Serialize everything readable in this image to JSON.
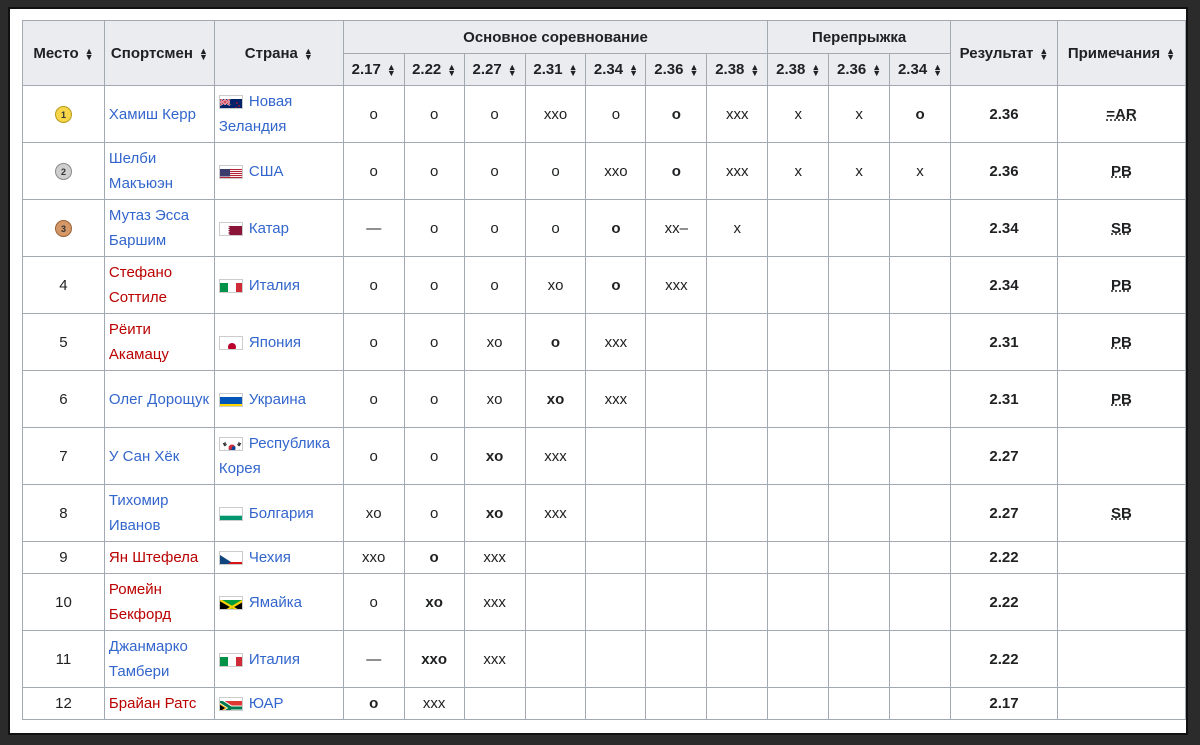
{
  "headers": {
    "place": "Место",
    "athlete": "Спортсмен",
    "country": "Страна",
    "main": "Основное соревнование",
    "jumpoff": "Перепрыжка",
    "result": "Результат",
    "notes": "Примечания",
    "heights_main": [
      "2.17",
      "2.22",
      "2.27",
      "2.31",
      "2.34",
      "2.36",
      "2.38"
    ],
    "heights_jumpoff": [
      "2.38",
      "2.36",
      "2.34"
    ]
  },
  "rows": [
    {
      "place": "",
      "medal": "gold",
      "medal_text": "1",
      "athlete": "Хамиш Керр",
      "athlete_link": "blue",
      "country": "Новая Зеландия",
      "flag": "nz",
      "attempts": [
        "o",
        "o",
        "o",
        "xxo",
        "o",
        "o",
        "xxx",
        "x",
        "x",
        "o"
      ],
      "bold": [
        5,
        9
      ],
      "result": "2.36",
      "note": "=AR"
    },
    {
      "place": "",
      "medal": "silver",
      "medal_text": "2",
      "athlete": "Шелби Макъюэн",
      "athlete_link": "blue",
      "country": "США",
      "flag": "us",
      "attempts": [
        "o",
        "o",
        "o",
        "o",
        "xxo",
        "o",
        "xxx",
        "x",
        "x",
        "x"
      ],
      "bold": [
        5
      ],
      "result": "2.36",
      "note": "PB"
    },
    {
      "place": "",
      "medal": "bronze",
      "medal_text": "3",
      "athlete": "Мутаз Эсса Баршим",
      "athlete_link": "blue",
      "country": "Катар",
      "flag": "qa",
      "attempts": [
        "—",
        "o",
        "o",
        "o",
        "o",
        "xx–",
        "x",
        "",
        "",
        ""
      ],
      "bold": [
        4
      ],
      "result": "2.34",
      "note": "SB"
    },
    {
      "place": "4",
      "medal": "",
      "medal_text": "",
      "athlete": "Стефано Соттиле",
      "athlete_link": "red",
      "country": "Италия",
      "flag": "it",
      "attempts": [
        "o",
        "o",
        "o",
        "xo",
        "o",
        "xxx",
        "",
        "",
        "",
        ""
      ],
      "bold": [
        4
      ],
      "result": "2.34",
      "note": "PB"
    },
    {
      "place": "5",
      "medal": "",
      "medal_text": "",
      "athlete": "Рёити Акамацу",
      "athlete_link": "red",
      "country": "Япония",
      "flag": "jp",
      "attempts": [
        "o",
        "o",
        "xo",
        "o",
        "xxx",
        "",
        "",
        "",
        "",
        ""
      ],
      "bold": [
        3
      ],
      "result": "2.31",
      "note": "PB"
    },
    {
      "place": "6",
      "medal": "",
      "medal_text": "",
      "athlete": "Олег Дорощук",
      "athlete_link": "blue",
      "country": "Украина",
      "flag": "ua",
      "attempts": [
        "o",
        "o",
        "xo",
        "xo",
        "xxx",
        "",
        "",
        "",
        "",
        ""
      ],
      "bold": [
        3
      ],
      "result": "2.31",
      "note": "PB"
    },
    {
      "place": "7",
      "medal": "",
      "medal_text": "",
      "athlete": "У Сан Хёк",
      "athlete_link": "blue",
      "country": "Республика Корея",
      "flag": "kr",
      "attempts": [
        "o",
        "o",
        "xo",
        "xxx",
        "",
        "",
        "",
        "",
        "",
        ""
      ],
      "bold": [
        2
      ],
      "result": "2.27",
      "note": ""
    },
    {
      "place": "8",
      "medal": "",
      "medal_text": "",
      "athlete": "Тихомир Иванов",
      "athlete_link": "blue",
      "country": "Болгария",
      "flag": "bg",
      "attempts": [
        "xo",
        "o",
        "xo",
        "xxx",
        "",
        "",
        "",
        "",
        "",
        ""
      ],
      "bold": [
        2
      ],
      "result": "2.27",
      "note": "SB"
    },
    {
      "place": "9",
      "medal": "",
      "medal_text": "",
      "athlete": "Ян Штефела",
      "athlete_link": "red",
      "country": "Чехия",
      "flag": "cz",
      "attempts": [
        "xxo",
        "o",
        "xxx",
        "",
        "",
        "",
        "",
        "",
        "",
        ""
      ],
      "bold": [
        1
      ],
      "result": "2.22",
      "note": "",
      "short": true
    },
    {
      "place": "10",
      "medal": "",
      "medal_text": "",
      "athlete": "Ромейн Бекфорд",
      "athlete_link": "red",
      "country": "Ямайка",
      "flag": "jm",
      "attempts": [
        "o",
        "xo",
        "xxx",
        "",
        "",
        "",
        "",
        "",
        "",
        ""
      ],
      "bold": [
        1
      ],
      "result": "2.22",
      "note": ""
    },
    {
      "place": "11",
      "medal": "",
      "medal_text": "",
      "athlete": "Джанмарко Тамбери",
      "athlete_link": "blue",
      "country": "Италия",
      "flag": "it",
      "attempts": [
        "—",
        "xxo",
        "xxx",
        "",
        "",
        "",
        "",
        "",
        "",
        ""
      ],
      "bold": [
        1
      ],
      "result": "2.22",
      "note": ""
    },
    {
      "place": "12",
      "medal": "",
      "medal_text": "",
      "athlete": "Брайан Ратс",
      "athlete_link": "red",
      "country": "ЮАР",
      "flag": "za",
      "attempts": [
        "o",
        "xxx",
        "",
        "",
        "",
        "",
        "",
        "",
        "",
        ""
      ],
      "bold": [
        0
      ],
      "result": "2.17",
      "note": "",
      "short": true
    }
  ],
  "colors": {
    "link": "#3366cc",
    "redlink": "#ba0000",
    "header_bg": "#eaecf0",
    "border": "#a2a9b1"
  }
}
